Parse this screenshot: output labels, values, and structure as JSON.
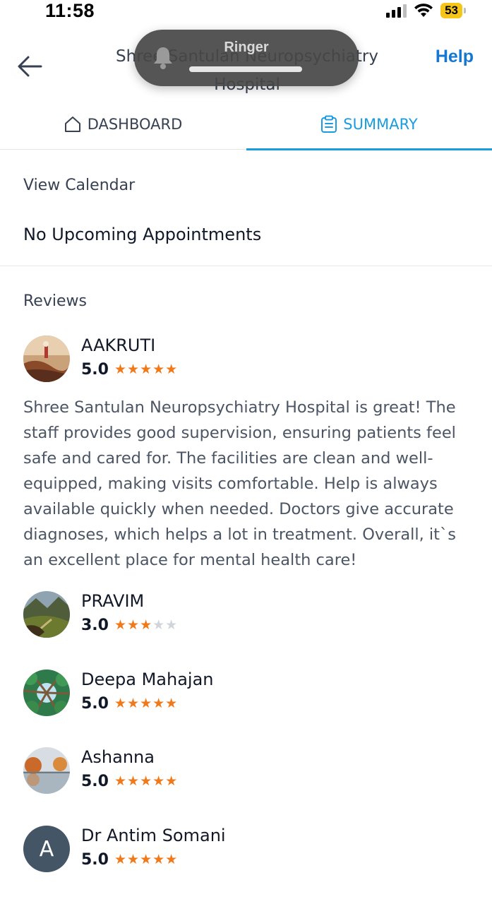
{
  "status": {
    "time": "11:58",
    "battery": "53"
  },
  "header": {
    "title": "Shree Santulan Neuropsychiatry Hospital",
    "help": "Help"
  },
  "ringer": {
    "label": "Ringer"
  },
  "tabs": [
    {
      "label": "DASHBOARD",
      "active": false
    },
    {
      "label": "SUMMARY",
      "active": true
    }
  ],
  "calendar": {
    "view_label": "View Calendar",
    "empty_text": "No Upcoming Appointments"
  },
  "reviews": {
    "heading": "Reviews",
    "items": [
      {
        "name": "AAKRUTI",
        "rating": "5.0",
        "stars": 5,
        "text": "Shree Santulan Neuropsychiatry Hospital is great! The staff provides good supervision, ensuring patients feel safe and cared for. The facilities are clean and well-equipped, making visits comfortable. Help is always available quickly when needed. Doctors give accurate diagnoses, which helps a lot in treatment. Overall, it`s an excellent place for mental health care!"
      },
      {
        "name": "PRAVIM",
        "rating": "3.0",
        "stars": 3,
        "text": ""
      },
      {
        "name": "Deepa Mahajan",
        "rating": "5.0",
        "stars": 5,
        "text": ""
      },
      {
        "name": "Ashanna",
        "rating": "5.0",
        "stars": 5,
        "text": ""
      },
      {
        "name": "Dr Antim Somani",
        "rating": "5.0",
        "stars": 5,
        "text": "",
        "initial": "A"
      }
    ]
  },
  "colors": {
    "accent": "#1a9ce0",
    "help": "#1677d2",
    "star": "#f07a1a",
    "star_off": "#d1d5db"
  }
}
